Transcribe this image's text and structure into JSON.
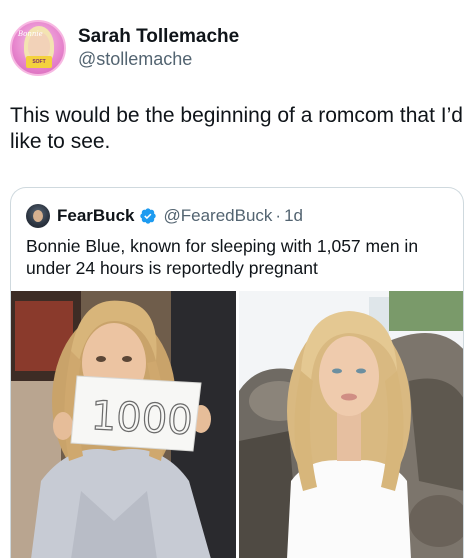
{
  "post": {
    "author": {
      "display_name": "Sarah Tollemache",
      "handle": "@stollemache",
      "avatar_icon": "profile-avatar"
    },
    "text": "This would be the beginning of a romcom that I’d like to see."
  },
  "quoted_post": {
    "author": {
      "display_name": "FearBuck",
      "handle": "@FearedBuck",
      "verified": true,
      "avatar_icon": "profile-avatar"
    },
    "separator": "·",
    "time": "1d",
    "text": "Bonnie Blue, known for sleeping with 1,057 men in under 24 hours is reportedly pregnant",
    "media": [
      {
        "icon": "photo-woman-holding-sign",
        "sign_text": "1000"
      },
      {
        "icon": "photo-woman-white-shirt"
      }
    ]
  },
  "colors": {
    "text": "#0f1419",
    "secondary": "#536471",
    "border": "#cfd9de",
    "verified": "#1d9bf0"
  }
}
